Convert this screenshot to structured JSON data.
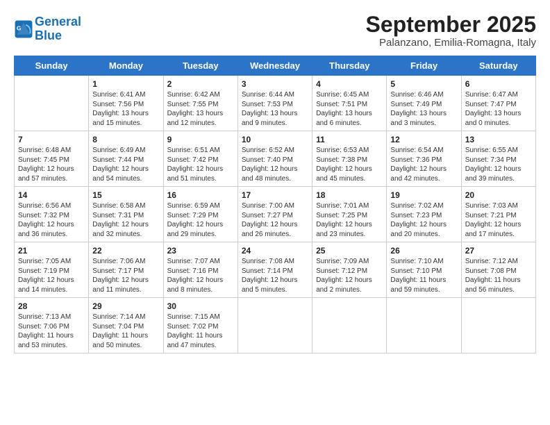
{
  "logo": {
    "line1": "General",
    "line2": "Blue"
  },
  "title": "September 2025",
  "subtitle": "Palanzano, Emilia-Romagna, Italy",
  "weekdays": [
    "Sunday",
    "Monday",
    "Tuesday",
    "Wednesday",
    "Thursday",
    "Friday",
    "Saturday"
  ],
  "weeks": [
    [
      {
        "day": "",
        "info": ""
      },
      {
        "day": "1",
        "info": "Sunrise: 6:41 AM\nSunset: 7:56 PM\nDaylight: 13 hours\nand 15 minutes."
      },
      {
        "day": "2",
        "info": "Sunrise: 6:42 AM\nSunset: 7:55 PM\nDaylight: 13 hours\nand 12 minutes."
      },
      {
        "day": "3",
        "info": "Sunrise: 6:44 AM\nSunset: 7:53 PM\nDaylight: 13 hours\nand 9 minutes."
      },
      {
        "day": "4",
        "info": "Sunrise: 6:45 AM\nSunset: 7:51 PM\nDaylight: 13 hours\nand 6 minutes."
      },
      {
        "day": "5",
        "info": "Sunrise: 6:46 AM\nSunset: 7:49 PM\nDaylight: 13 hours\nand 3 minutes."
      },
      {
        "day": "6",
        "info": "Sunrise: 6:47 AM\nSunset: 7:47 PM\nDaylight: 13 hours\nand 0 minutes."
      }
    ],
    [
      {
        "day": "7",
        "info": "Sunrise: 6:48 AM\nSunset: 7:45 PM\nDaylight: 12 hours\nand 57 minutes."
      },
      {
        "day": "8",
        "info": "Sunrise: 6:49 AM\nSunset: 7:44 PM\nDaylight: 12 hours\nand 54 minutes."
      },
      {
        "day": "9",
        "info": "Sunrise: 6:51 AM\nSunset: 7:42 PM\nDaylight: 12 hours\nand 51 minutes."
      },
      {
        "day": "10",
        "info": "Sunrise: 6:52 AM\nSunset: 7:40 PM\nDaylight: 12 hours\nand 48 minutes."
      },
      {
        "day": "11",
        "info": "Sunrise: 6:53 AM\nSunset: 7:38 PM\nDaylight: 12 hours\nand 45 minutes."
      },
      {
        "day": "12",
        "info": "Sunrise: 6:54 AM\nSunset: 7:36 PM\nDaylight: 12 hours\nand 42 minutes."
      },
      {
        "day": "13",
        "info": "Sunrise: 6:55 AM\nSunset: 7:34 PM\nDaylight: 12 hours\nand 39 minutes."
      }
    ],
    [
      {
        "day": "14",
        "info": "Sunrise: 6:56 AM\nSunset: 7:32 PM\nDaylight: 12 hours\nand 36 minutes."
      },
      {
        "day": "15",
        "info": "Sunrise: 6:58 AM\nSunset: 7:31 PM\nDaylight: 12 hours\nand 32 minutes."
      },
      {
        "day": "16",
        "info": "Sunrise: 6:59 AM\nSunset: 7:29 PM\nDaylight: 12 hours\nand 29 minutes."
      },
      {
        "day": "17",
        "info": "Sunrise: 7:00 AM\nSunset: 7:27 PM\nDaylight: 12 hours\nand 26 minutes."
      },
      {
        "day": "18",
        "info": "Sunrise: 7:01 AM\nSunset: 7:25 PM\nDaylight: 12 hours\nand 23 minutes."
      },
      {
        "day": "19",
        "info": "Sunrise: 7:02 AM\nSunset: 7:23 PM\nDaylight: 12 hours\nand 20 minutes."
      },
      {
        "day": "20",
        "info": "Sunrise: 7:03 AM\nSunset: 7:21 PM\nDaylight: 12 hours\nand 17 minutes."
      }
    ],
    [
      {
        "day": "21",
        "info": "Sunrise: 7:05 AM\nSunset: 7:19 PM\nDaylight: 12 hours\nand 14 minutes."
      },
      {
        "day": "22",
        "info": "Sunrise: 7:06 AM\nSunset: 7:17 PM\nDaylight: 12 hours\nand 11 minutes."
      },
      {
        "day": "23",
        "info": "Sunrise: 7:07 AM\nSunset: 7:16 PM\nDaylight: 12 hours\nand 8 minutes."
      },
      {
        "day": "24",
        "info": "Sunrise: 7:08 AM\nSunset: 7:14 PM\nDaylight: 12 hours\nand 5 minutes."
      },
      {
        "day": "25",
        "info": "Sunrise: 7:09 AM\nSunset: 7:12 PM\nDaylight: 12 hours\nand 2 minutes."
      },
      {
        "day": "26",
        "info": "Sunrise: 7:10 AM\nSunset: 7:10 PM\nDaylight: 11 hours\nand 59 minutes."
      },
      {
        "day": "27",
        "info": "Sunrise: 7:12 AM\nSunset: 7:08 PM\nDaylight: 11 hours\nand 56 minutes."
      }
    ],
    [
      {
        "day": "28",
        "info": "Sunrise: 7:13 AM\nSunset: 7:06 PM\nDaylight: 11 hours\nand 53 minutes."
      },
      {
        "day": "29",
        "info": "Sunrise: 7:14 AM\nSunset: 7:04 PM\nDaylight: 11 hours\nand 50 minutes."
      },
      {
        "day": "30",
        "info": "Sunrise: 7:15 AM\nSunset: 7:02 PM\nDaylight: 11 hours\nand 47 minutes."
      },
      {
        "day": "",
        "info": ""
      },
      {
        "day": "",
        "info": ""
      },
      {
        "day": "",
        "info": ""
      },
      {
        "day": "",
        "info": ""
      }
    ]
  ]
}
